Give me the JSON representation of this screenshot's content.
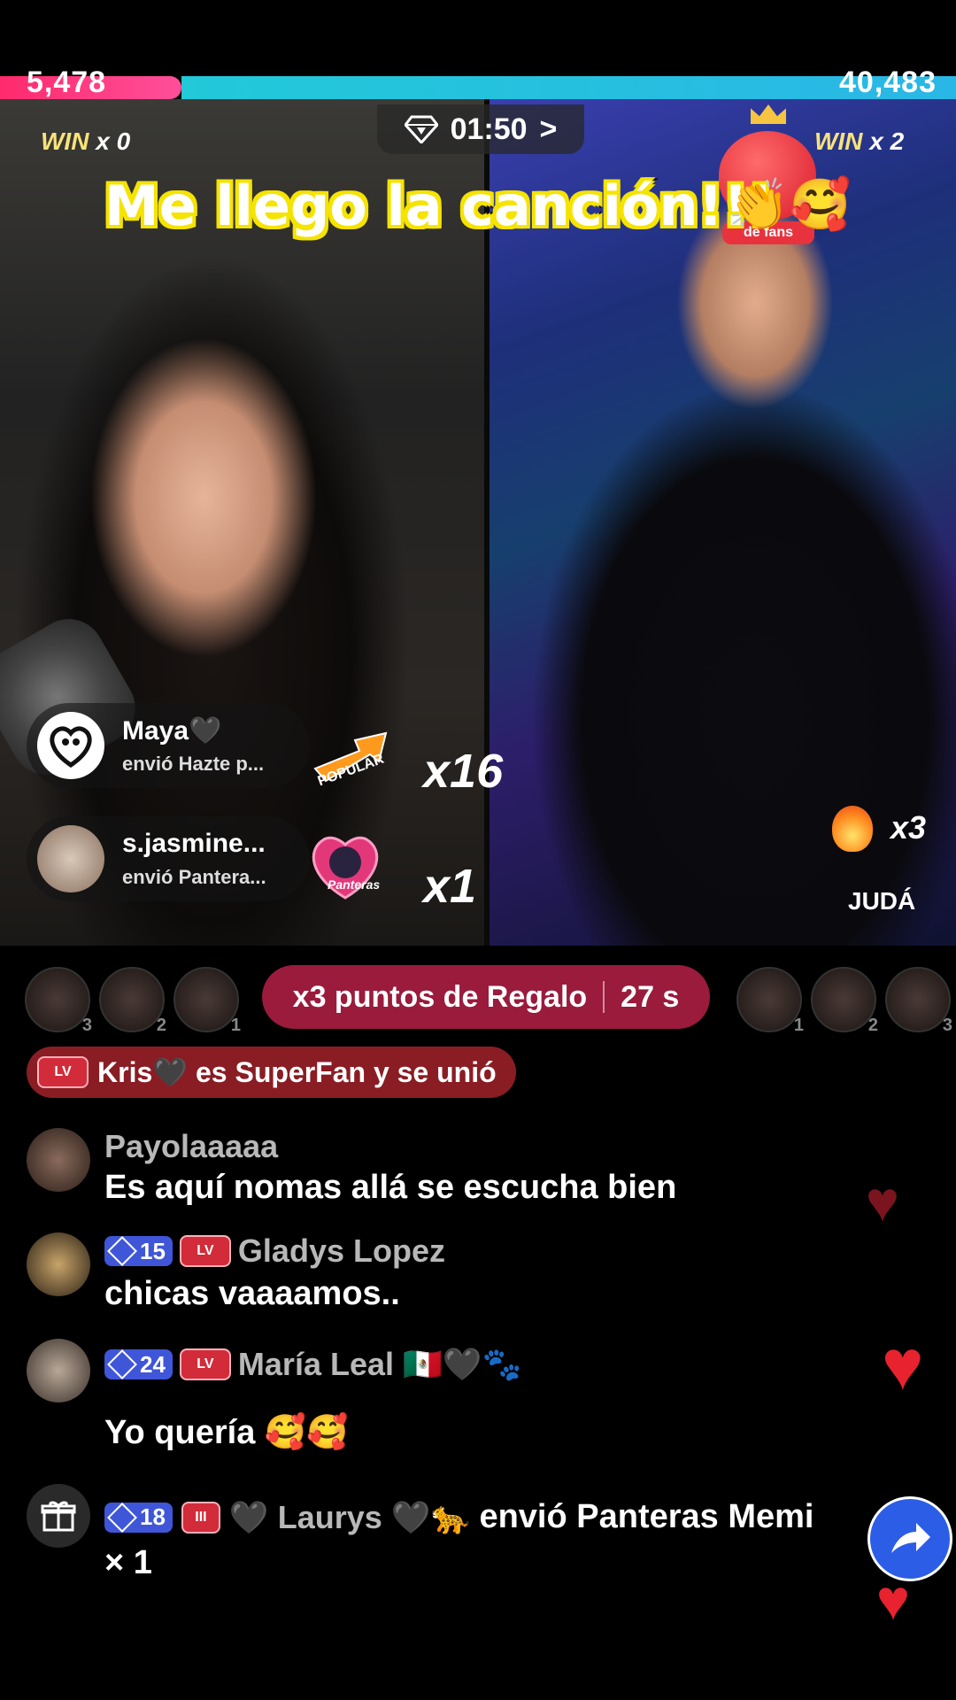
{
  "battle": {
    "left_score": "5,478",
    "right_score": "40,483",
    "timer": "01:50",
    "timer_chevron": ">",
    "left_win_label": "WIN",
    "left_win_count": "x 0",
    "right_win_label": "WIN",
    "right_win_count": "x 2",
    "left_color": "#ff2a6d",
    "right_color": "#22c9d8",
    "fan_heart_label": "de fans"
  },
  "caption": {
    "text": "Me llego la canción!!!",
    "emoji": "👏🥰"
  },
  "gift_toasts": [
    {
      "name": "Maya🖤",
      "action": "envió Hazte p...",
      "gift_label": "POPULAR",
      "multiplier": "x16"
    },
    {
      "name": "s.jasmine...",
      "action": "envió Pantera...",
      "gift_label": "Panteras",
      "multiplier": "x1"
    }
  ],
  "right_host": {
    "fire_multiplier": "x3",
    "name": "JUDÁ"
  },
  "rankings": {
    "left": [
      "3",
      "2",
      "1"
    ],
    "right": [
      "1",
      "2",
      "3"
    ]
  },
  "points_bar": {
    "label": "x3 puntos de Regalo",
    "time": "27 s"
  },
  "superfan_banner": {
    "badge": "LV",
    "text": "Kris🖤 es SuperFan y se unió"
  },
  "comments": [
    {
      "name": "Payolaaaaa",
      "text": "Es aquí nomas allá se escucha bien"
    },
    {
      "gem_level": "15",
      "badge": "LV",
      "name": "Gladys Lopez",
      "text": "chicas vaaaamos.."
    },
    {
      "gem_level": "24",
      "badge": "LV",
      "name": "María Leal 🇲🇽🖤🐾",
      "text": "Yo quería 🥰🥰"
    }
  ],
  "gift_comment": {
    "gem_level": "18",
    "badge": "III",
    "name": "🖤 Laurys 🖤🐆",
    "text": "envió Panteras Memi",
    "count": "× 1"
  }
}
